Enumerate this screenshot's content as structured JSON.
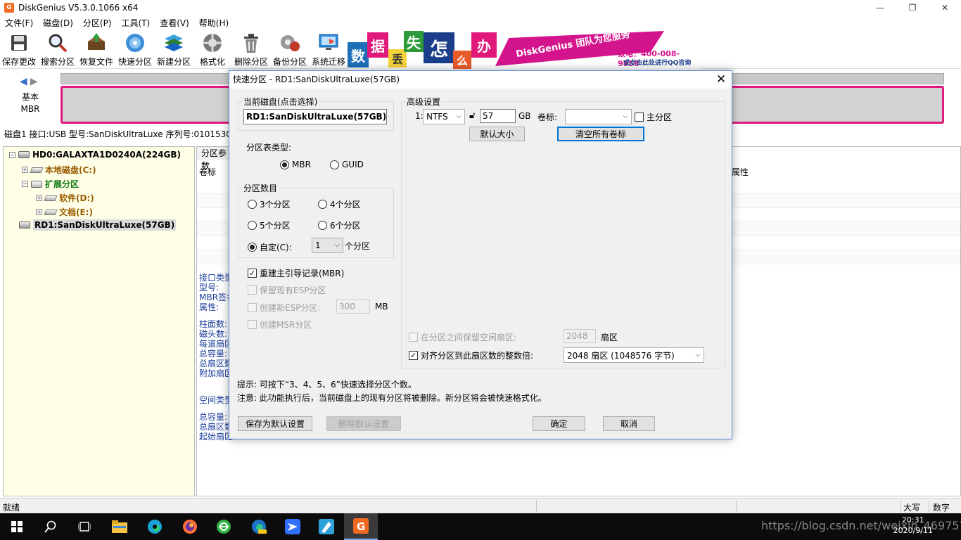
{
  "window": {
    "title": "DiskGenius V5.3.0.1066 x64",
    "app_icon_text": "G",
    "controls": [
      "—",
      "❐",
      "✕"
    ]
  },
  "menu": [
    "文件(F)",
    "磁盘(D)",
    "分区(P)",
    "工具(T)",
    "查看(V)",
    "帮助(H)"
  ],
  "toolbar": [
    {
      "label": "保存更改",
      "icon": "save-icon"
    },
    {
      "label": "搜索分区",
      "icon": "search-icon"
    },
    {
      "label": "恢复文件",
      "icon": "recover-files-icon"
    },
    {
      "label": "快速分区",
      "icon": "quick-partition-icon"
    },
    {
      "label": "新建分区",
      "icon": "new-partition-icon"
    },
    {
      "label": "格式化",
      "icon": "format-icon"
    },
    {
      "label": "删除分区",
      "icon": "delete-icon"
    },
    {
      "label": "备份分区",
      "icon": "backup-icon"
    },
    {
      "label": "系统迁移",
      "icon": "migrate-icon"
    }
  ],
  "banner": {
    "tiles": [
      "数",
      "据",
      "丢",
      "失",
      "怎",
      "么",
      "办"
    ],
    "slogan": "DiskGenius 团队为您服务",
    "phone": "致电：400-008-9958",
    "qq": "或点击此处进行QQ咨询"
  },
  "disk_view": {
    "basic_label": "基本",
    "mbr_label": "MBR",
    "info_line": "磁盘1 接口:USB  型号:SanDiskUltraLuxe  序列号:0101530"
  },
  "tree": [
    {
      "label": "HD0:GALAXTA1D0240A(224GB)",
      "expander": "−",
      "icon": "hard-disk-icon"
    },
    {
      "label": "本地磁盘(C:)",
      "expander": "+",
      "icon": "volume-icon"
    },
    {
      "label": "扩展分区",
      "expander": "−",
      "icon": "extended-partition-icon"
    },
    {
      "label": "软件(D:)",
      "expander": "+",
      "icon": "volume-icon"
    },
    {
      "label": "文档(E:)",
      "expander": "+",
      "icon": "volume-icon"
    },
    {
      "label": "RD1:SanDiskUltraLuxe(57GB)",
      "expander": "",
      "icon": "hard-disk-icon"
    }
  ],
  "right_panel": {
    "tab": "分区参数",
    "col_label": "卷标",
    "col_attr": "属性",
    "info_group1": [
      "接口类型",
      "型号:",
      "MBR签名",
      "属性:"
    ],
    "info_group2": [
      "柱面数:",
      "磁头数:",
      "每道扇区",
      "总容量:",
      "总扇区数",
      "附加扇区"
    ],
    "info_group3": [
      "空间类型"
    ],
    "info_group4": [
      "总容量:",
      "总扇区数",
      "起始扇区"
    ]
  },
  "status": {
    "left": "就绪",
    "caps": "大写",
    "num": "数字"
  },
  "taskbar": {
    "icons": [
      "start-icon",
      "search-icon",
      "task-view-icon",
      "file-explorer-icon",
      "edge-icon",
      "firefox-icon",
      "360-browser-icon",
      "edge-canary-icon",
      "feishu-icon",
      "tool-icon",
      "diskgenius-icon"
    ],
    "time": "20:31",
    "date": "2020/9/11",
    "watermark": "https://blog.csdn.net/weixin_46975714"
  },
  "dialog": {
    "title": "快速分区 - RD1:SanDiskUltraLuxe(57GB)",
    "current_disk_label": "当前磁盘(点击选择)",
    "current_disk_value": "RD1:SanDiskUltraLuxe(57GB)",
    "table_type_label": "分区表类型:",
    "table_type_options": [
      "MBR",
      "GUID"
    ],
    "table_type_selected": "MBR",
    "count_label": "分区数目",
    "count_options": [
      "3个分区",
      "4个分区",
      "5个分区",
      "6个分区",
      "自定(C):"
    ],
    "count_selected": "自定(C):",
    "custom_count": "1",
    "custom_count_unit": "个分区",
    "rebuild_mbr": "重建主引导记录(MBR)",
    "keep_esp": "保留现有ESP分区",
    "create_esp": "创建新ESP分区:",
    "esp_size": "300",
    "esp_unit": "MB",
    "create_msr": "创建MSR分区",
    "advanced_label": "高级设置",
    "row_index": "1:",
    "fs": "NTFS",
    "size": "57",
    "size_unit": "GB",
    "volume_label": "卷标:",
    "volume_value": "",
    "primary": "主分区",
    "default_size_btn": "默认大小",
    "clear_labels_btn": "清空所有卷标",
    "keep_free_label": "在分区之间保留空闲扇区:",
    "keep_free_value": "2048",
    "keep_free_unit": "扇区",
    "align_label": "对齐分区到此扇区数的整数倍:",
    "align_value": "2048 扇区 (1048576 字节)",
    "tip": "提示: 可按下“3、4、5、6”快速选择分区个数。",
    "note": "注意: 此功能执行后，当前磁盘上的现有分区将被删除。新分区将会被快速格式化。",
    "save_default_btn": "保存为默认设置",
    "delete_default_btn": "删除默认设置",
    "ok_btn": "确定",
    "cancel_btn": "取消"
  },
  "colors": {
    "accent_pink": "#e0197a",
    "brand_orange": "#f26a22",
    "tree_bg": "#ffffe8",
    "link_blue": "#1a3e9a"
  }
}
